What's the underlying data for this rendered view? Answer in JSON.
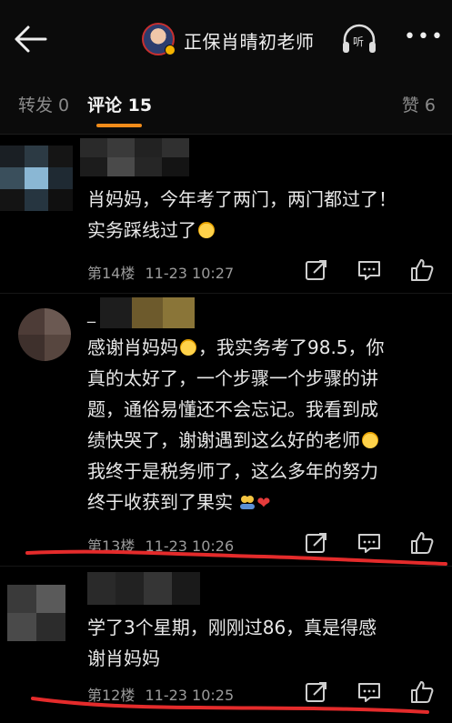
{
  "header": {
    "title": "正保肖晴初老师",
    "listen_label": "听"
  },
  "tabs": {
    "repost": "转发 0",
    "comment": "评论 15",
    "like": "赞 6"
  },
  "colors": {
    "accent": "#f28c1a",
    "annotation": "#e42b2b",
    "background": "#000000"
  },
  "icons": [
    "back-arrow-icon",
    "headphones-icon",
    "more-icon",
    "repost-icon",
    "reply-icon",
    "like-icon"
  ],
  "comments": [
    {
      "name": "",
      "lines": [
        "肖妈妈，今年考了两门，两门都过了！",
        "实务踩线过了"
      ],
      "floor": "第14楼",
      "time": "11-23 10:27"
    },
    {
      "name": "_",
      "lines": [
        "感谢肖妈妈",
        "，我实务考了98.5，你",
        "真的太好了，一个步骤一个步骤的讲",
        "题，通俗易懂还不会忘记。我看到成",
        "绩快哭了，谢谢遇到这么好的老师",
        "我终于是税务师了，这么多年的努力",
        "终于收获到了果实"
      ],
      "floor": "第13楼",
      "time": "11-23 10:26"
    },
    {
      "name": "",
      "lines": [
        "学了3个星期，刚刚过86，真是得感",
        "谢肖妈妈"
      ],
      "floor": "第12楼",
      "time": "11-23 10:25"
    }
  ]
}
